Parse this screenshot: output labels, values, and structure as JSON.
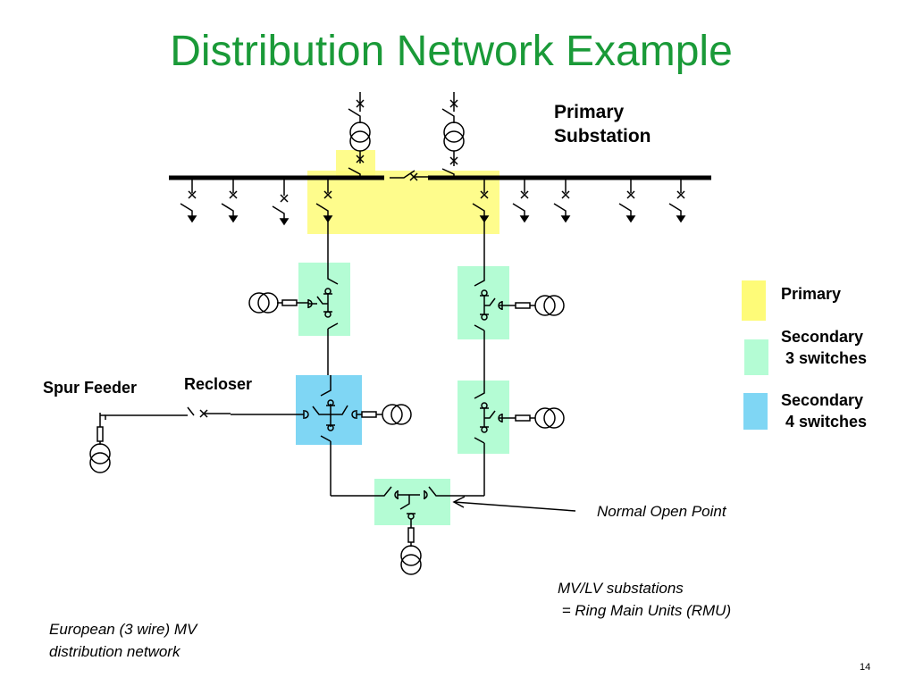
{
  "title": "Distribution Network Example",
  "labels": {
    "primary_substation": [
      "Primary",
      "Substation"
    ],
    "spur_feeder": "Spur Feeder",
    "recloser": "Recloser",
    "normal_open_point": "Normal Open Point",
    "mvlv": [
      "MV/LV substations",
      " = Ring Main Units (RMU)"
    ],
    "european": [
      "European (3 wire) MV",
      "distribution network"
    ]
  },
  "legend": [
    {
      "label": "Primary",
      "color": "#fefb78"
    },
    {
      "label": "Secondary\n 3 switches",
      "color": "#b4fcd4"
    },
    {
      "label": "Secondary\n 4 switches",
      "color": "#7fd6f4"
    }
  ],
  "colors": {
    "title": "#1a9a38",
    "primary_zone": "#fefb78",
    "secondary3_zone": "#b4fcd4",
    "secondary4_zone": "#7fd6f4",
    "line": "#000000"
  },
  "page_number": "14"
}
